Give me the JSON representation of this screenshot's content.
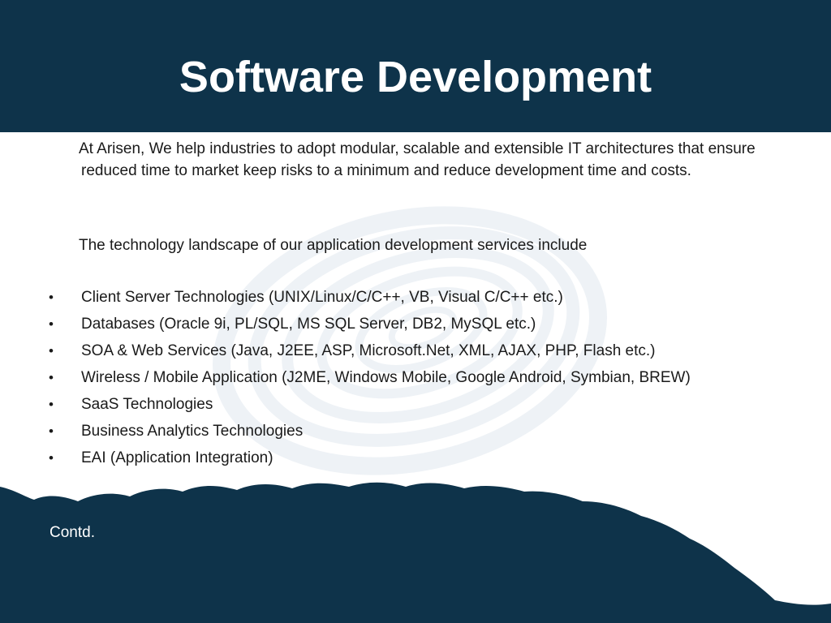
{
  "slide": {
    "title": "Software Development",
    "intro": "At Arisen, We help industries to adopt modular, scalable and extensible IT architectures that ensure reduced time to market keep risks to a minimum and reduce development time and costs.",
    "landscape": "The technology landscape of our application development services include",
    "bullet_symbol": "•",
    "bullets": [
      "Client Server Technologies (UNIX/Linux/C/C++, VB, Visual C/C++ etc.)",
      "Databases (Oracle 9i, PL/SQL, MS SQL Server, DB2, MySQL etc.)",
      "SOA & Web Services (Java, J2EE, ASP, Microsoft.Net, XML, AJAX, PHP, Flash etc.)",
      "Wireless / Mobile Application (J2ME, Windows Mobile, Google Android, Symbian, BREW)",
      "SaaS Technologies",
      "Business Analytics Technologies",
      "EAI (Application Integration)"
    ],
    "footer_text": "Contd."
  },
  "colors": {
    "band": "#0e334a",
    "title_text": "#ffffff",
    "body_text": "#1a1a1a",
    "swirl": "#cfdbe6"
  },
  "icons": {
    "background_swirl": "swirl-icon"
  }
}
